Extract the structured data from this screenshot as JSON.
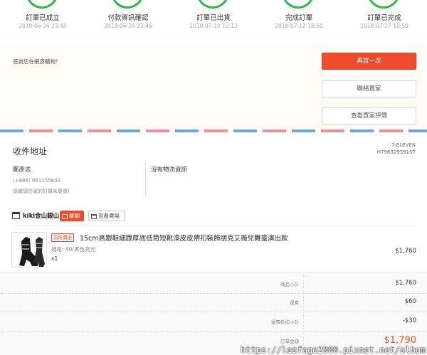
{
  "steps": [
    {
      "label": "訂單已成立",
      "time": "2018-06-24 23:45"
    },
    {
      "label": "付款資訊確認",
      "time": "2018-06-24 23:46"
    },
    {
      "label": "訂單已出貨",
      "time": "2018-07-10 12:13"
    },
    {
      "label": "完成訂單",
      "time": "2018-07-12 18:50"
    },
    {
      "label": "訂單已完成",
      "time": "2018-07-27 18:50"
    }
  ],
  "actions": {
    "thanks": "感謝您在蝦皮購物！",
    "buy_again": "再買一次",
    "contact_seller": "聯絡賣家",
    "view_rating": "查看買家評價"
  },
  "address": {
    "title": "收件地址",
    "carrier": "7-ELEVEN",
    "tracking": "H79632939157",
    "recipient": "鄭彥志",
    "phone": "(+886) 961155600",
    "note": "請確認住家的訂單未發貨！",
    "logistics": "沒有物流資訊"
  },
  "shop": {
    "name": "kiki金山銀山",
    "chat": "聊聊",
    "view_shop": "查看賣場"
  },
  "item": {
    "badge": "前所價值",
    "name": "15cm高跟鞋細跟厚底低筒短靴漆皮皮帶扣裝飾朋克艾薇兒舞臺演出款",
    "variation": "規格: 40/黑色亮光",
    "qty": "x1",
    "price": "$1,760"
  },
  "totals": [
    {
      "label": "商品小計",
      "value": "$1,760"
    },
    {
      "label": "運費",
      "value": "$60"
    },
    {
      "label": "運費折扣小計",
      "value": "-$30"
    },
    {
      "label": "訂單金額",
      "value": "$1,790"
    }
  ],
  "watermark": "https://leafage2000.pixnet.net/album",
  "colors": {
    "accent": "#ee4d2d",
    "step_green": "#2db84b",
    "banner_bg": "#fffcf5"
  }
}
